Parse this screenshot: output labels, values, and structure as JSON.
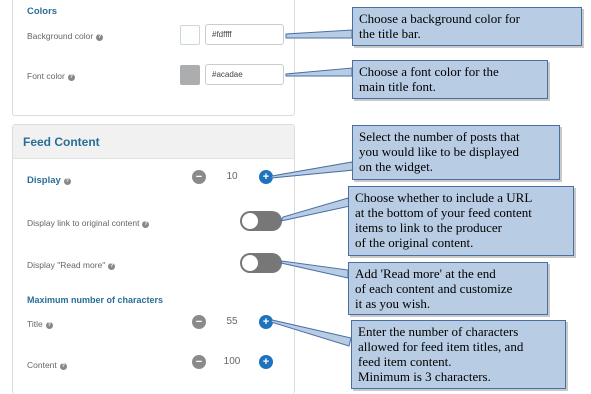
{
  "colors_section": {
    "title": "Colors",
    "background_label": "Background color",
    "background_value": "#fdffff",
    "background_swatch": "#fdffff",
    "font_label": "Font color",
    "font_value": "#acadae",
    "font_swatch": "#acadae"
  },
  "feed_content": {
    "header": "Feed Content",
    "display_label": "Display",
    "display_value": "10",
    "link_label": "Display link to original content",
    "readmore_label": "Display \"Read more\"",
    "max_chars_title": "Maximum number of characters",
    "title_label": "Title",
    "title_value": "55",
    "content_label": "Content",
    "content_value": "100"
  },
  "icons": {
    "help": "?",
    "minus": "−",
    "plus": "+"
  },
  "callouts": {
    "bg_color": "Choose a background color for\nthe title bar.",
    "font_color": "Choose a font color for the\nmain title font.",
    "posts": "Select the number of posts that\nyou would like to be displayed\non the widget.",
    "url": "Choose whether to include a URL\nat the bottom of your feed content\n items to link to the producer\nof the original content.",
    "read_more": "Add 'Read more' at the end\nof each content and customize\nit as you wish.",
    "chars": "Enter the number of characters\nallowed for feed item titles, and\nfeed item content.\nMinimum is 3 characters."
  },
  "accent_color": "#1e73be",
  "heading_color": "#2a6e96",
  "callout_color": "#b8cce4"
}
